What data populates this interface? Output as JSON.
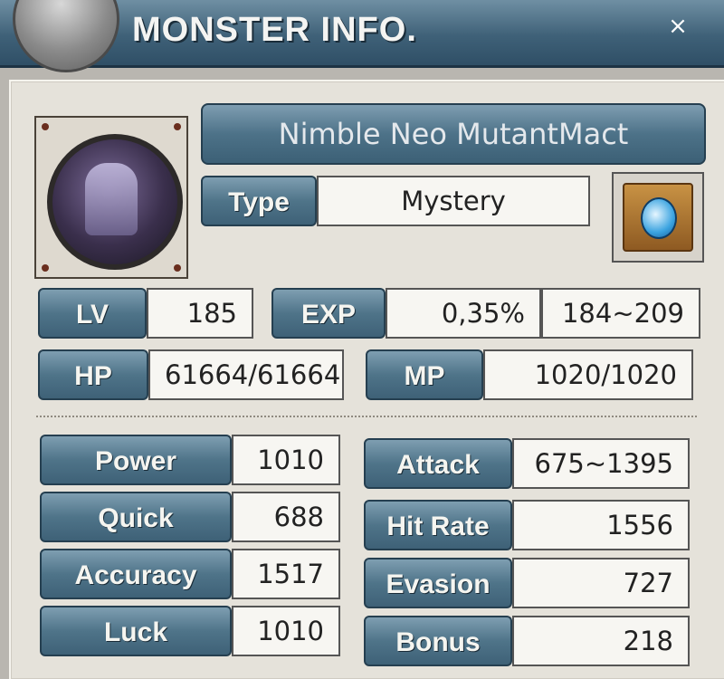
{
  "window": {
    "title": "MONSTER INFO.",
    "close_label": "×"
  },
  "monster": {
    "name": "Nimble Neo MutantMact",
    "type_label": "Type",
    "type_value": "Mystery"
  },
  "stats_top": {
    "lv_label": "LV",
    "lv_value": "185",
    "exp_label": "EXP",
    "exp_value": "0,35%",
    "exp_range": "184~209",
    "hp_label": "HP",
    "hp_value": "61664/61664",
    "mp_label": "MP",
    "mp_value": "1020/1020"
  },
  "stats_left": [
    {
      "label": "Power",
      "value": "1010"
    },
    {
      "label": "Quick",
      "value": "688"
    },
    {
      "label": "Accuracy",
      "value": "1517"
    },
    {
      "label": "Luck",
      "value": "1010"
    }
  ],
  "stats_right": [
    {
      "label": "Attack",
      "value": "675~1395"
    },
    {
      "label": "Hit Rate",
      "value": "1556"
    },
    {
      "label": "Evasion",
      "value": "727"
    },
    {
      "label": "Bonus",
      "value": "218"
    }
  ],
  "icons": {
    "portrait": "monster-portrait",
    "type": "mystery-type-icon",
    "close": "close-icon"
  }
}
